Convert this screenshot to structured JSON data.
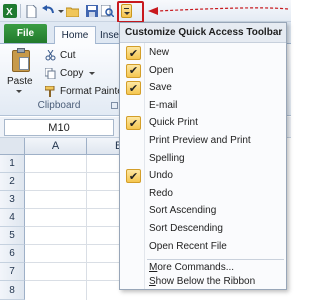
{
  "qat": {
    "icons": [
      "excel-logo-icon",
      "new-file-icon",
      "undo-icon",
      "undo-dropdown-icon",
      "open-folder-icon",
      "save-icon",
      "print-preview-icon",
      "customize-dropdown-icon"
    ],
    "highlight_color": "#c8191e"
  },
  "tabs": {
    "file": "File",
    "home": "Home",
    "insert": "Inse"
  },
  "ribbon": {
    "paste": "Paste",
    "cut": "Cut",
    "copy": "Copy",
    "format_painter": "Format Painter",
    "group_label": "Clipboard"
  },
  "name_box": "M10",
  "grid": {
    "columns": [
      "A",
      "B"
    ],
    "rows": [
      "1",
      "2",
      "3",
      "4",
      "5",
      "6",
      "7",
      "8"
    ]
  },
  "menu": {
    "title": "Customize Quick Access Toolbar",
    "items": [
      {
        "label": "New",
        "checked": true
      },
      {
        "label": "Open",
        "checked": true
      },
      {
        "label": "Save",
        "checked": true
      },
      {
        "label": "E-mail",
        "checked": false
      },
      {
        "label": "Quick Print",
        "checked": true
      },
      {
        "label": "Print Preview and Print",
        "checked": false
      },
      {
        "label": "Spelling",
        "checked": false
      },
      {
        "label": "Undo",
        "checked": true
      },
      {
        "label": "Redo",
        "checked": false
      },
      {
        "label": "Sort Ascending",
        "checked": false
      },
      {
        "label": "Sort Descending",
        "checked": false
      },
      {
        "label": "Open Recent File",
        "checked": false
      }
    ],
    "more_commands": "More Commands...",
    "show_below": "Show Below the Ribbon"
  },
  "accent_colors": {
    "file_tab": "#217a2c",
    "checkmark_highlight": "#f5c64f",
    "annotation": "#c8191e"
  }
}
